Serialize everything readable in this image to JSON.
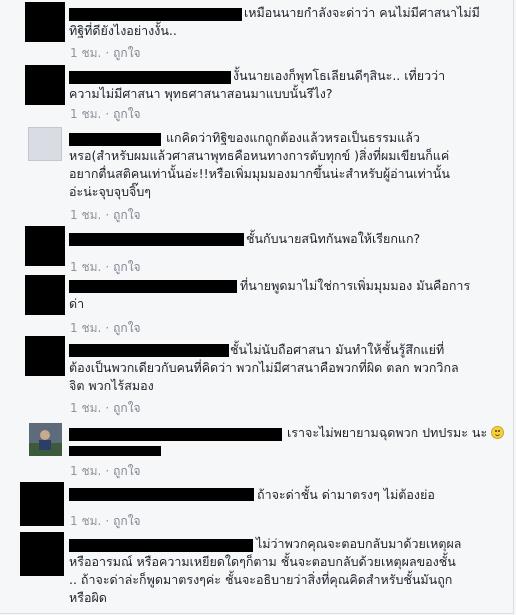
{
  "comments": [
    {
      "text": "เหมือนนายกำลังจะด่าว่า คนไม่มีศาสนาไม่มี\nทิฐิที่ดียังไงอย่างงั้น..",
      "time": "1 ชม.",
      "like": "ถูกใจ"
    },
    {
      "text": "งั้นนายเองก็พุทโธเลียนดีๆสินะ.. เที่ยวว่า\nความไม่มีศาสนา พุทธศาสนาสอนมาแบบนั้นรึไง?",
      "time": "1 ชม.",
      "like": "ถูกใจ"
    },
    {
      "text": "แกคิดว่าทิฐิของแกถูกต้องแล้วหรอเป็นธรรมแล้ว\nหรอ(สำหรับผมแล้วศาสนาพุทธคือหนทางการดับทุกข์ )สิ่งที่ผมเขียนก็แค่\nอยากตื่นสติคนเท่านั้นอ่ะ!!หรือเพิ่มมุมมองมากขึ้นน่ะสำหรับผู้อ่านเท่านั้น\nอ่ะน่ะจุบจุบจิ๊บๆ",
      "time": "1 ชม.",
      "like": "ถูกใจ"
    },
    {
      "text": "ชั้นกับนายสนิทกันพอให้เรียกแก?",
      "time": "1 ชม.",
      "like": "ถูกใจ"
    },
    {
      "text": "ที่นายพูดมาไม่ใช่การเพิ่มมุมมอง มันคือการ\nด่า",
      "time": "1 ชม.",
      "like": "ถูกใจ"
    },
    {
      "text": "ชั้นไม่นับถือศาสนา มันทำให้ชั้นรู้สึกแย่ที่\nต้องเป็นพวกเดียวกับคนที่คิดว่า พวกไม่มีศาสนาคือพวกที่ผิด ตลก พวกวิกล\nจิต พวกไร้สมอง",
      "time": "1 ชม.",
      "like": "ถูกใจ"
    },
    {
      "text": "เราจะไม่พยายามฉุดพวก ปทปรมะ นะ",
      "time": "1 ชม.",
      "like": "ถูกใจ"
    },
    {
      "text": "ถ้าจะด่าชั้น ด่ามาตรงๆ ไม่ต้องย่อ",
      "time": "1 ชม.",
      "like": "ถูกใจ"
    },
    {
      "text": "ไม่ว่าพวกคุณจะตอบกลับมาด้วยเหตุผล\nหรืออารมณ์ หรือความเหยียดใดๆก็ตาม ชั้นจะตอบกลับด้วยเหตุผลของชั้น\n.. ถ้าจะด่าล่ะก็พูดมาตรงๆค่ะ ชั้นจะอธิบายว่าสิ่งที่คุณคิดสำหรับชั้นมันถูก\nหรือผิด",
      "time": "",
      "like": ""
    }
  ]
}
